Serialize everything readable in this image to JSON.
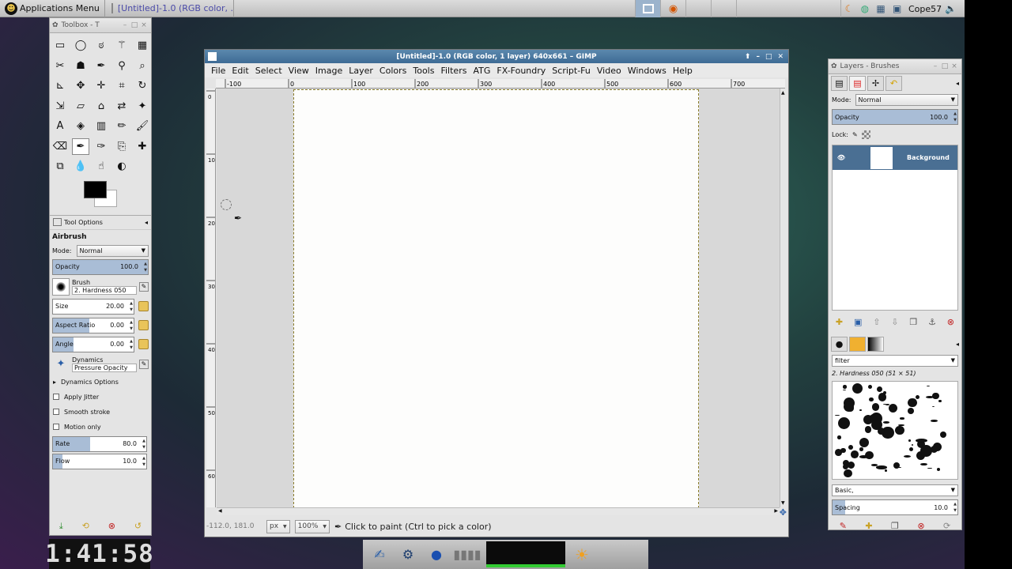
{
  "topbar": {
    "app_menu": "Applications Menu",
    "task_title": "[Untitled]-1.0 (RGB color, ...",
    "user": "Cope57"
  },
  "toolbox": {
    "title": "Toolbox - T",
    "tool_options_tab": "Tool Options",
    "tool_name": "Airbrush",
    "mode_label": "Mode:",
    "mode_value": "Normal",
    "opacity_label": "Opacity",
    "opacity_value": "100.0",
    "opacity_level": 1.0,
    "brush_label": "Brush",
    "brush_value": "2. Hardness 050",
    "size_label": "Size",
    "size_value": "20.00",
    "aspect_label": "Aspect Ratio",
    "aspect_value": "0.00",
    "angle_label": "Angle",
    "angle_value": "0.00",
    "dynamics_label": "Dynamics",
    "dynamics_value": "Pressure Opacity",
    "dynamics_options": "Dynamics Options",
    "apply_jitter": "Apply Jitter",
    "smooth_stroke": "Smooth stroke",
    "motion_only": "Motion only",
    "rate_label": "Rate",
    "rate_value": "80.0",
    "rate_level": 0.4,
    "flow_label": "Flow",
    "flow_value": "10.0",
    "flow_level": 0.1,
    "tools": [
      "rect-select",
      "ellipse-select",
      "free-select",
      "fuzzy-select",
      "color-select",
      "scissors",
      "foreground-select",
      "paths",
      "color-picker",
      "zoom",
      "measure",
      "move",
      "align",
      "crop",
      "rotate",
      "scale",
      "shear",
      "perspective",
      "flip",
      "cage",
      "text",
      "bucket-fill",
      "blend",
      "pencil",
      "paintbrush",
      "eraser",
      "airbrush",
      "ink",
      "clone",
      "heal",
      "perspective-clone",
      "blur",
      "smudge",
      "dodge-burn"
    ],
    "clock": "1:41:58"
  },
  "gimp_window": {
    "title": "[Untitled]-1.0 (RGB color, 1 layer) 640x661 – GIMP",
    "menus": [
      "File",
      "Edit",
      "Select",
      "View",
      "Image",
      "Layer",
      "Colors",
      "Tools",
      "Filters",
      "ATG",
      "FX-Foundry",
      "Script-Fu",
      "Video",
      "Windows",
      "Help"
    ],
    "hruler_labels": [
      "-100",
      "0",
      "100",
      "200",
      "300",
      "400",
      "500",
      "600",
      "700"
    ],
    "vruler_labels": [
      "0",
      "100",
      "200",
      "300",
      "400",
      "500",
      "600"
    ],
    "coords": "-112.0, 181.0",
    "unit": "px",
    "zoom": "100%",
    "status": "Click to paint (Ctrl to pick a color)"
  },
  "layers_panel": {
    "title": "Layers - Brushes",
    "mode_label": "Mode:",
    "mode_value": "Normal",
    "opacity_label": "Opacity",
    "opacity_value": "100.0",
    "lock_label": "Lock:",
    "layer_name": "Background",
    "brush_filter": "filter",
    "brush_name": "2. Hardness 050 (51 × 51)",
    "brush_tag": "Basic,",
    "spacing_label": "Spacing",
    "spacing_value": "10.0",
    "spacing_level": 0.1
  }
}
